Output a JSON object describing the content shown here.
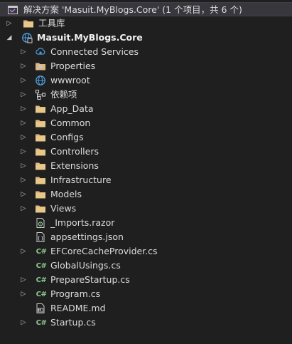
{
  "solution": {
    "label": "解决方案 'Masuit.MyBlogs.Core' (1 个项目，共 6 个)"
  },
  "toolbox": {
    "label": "工具库"
  },
  "project": {
    "label": "Masuit.MyBlogs.Core"
  },
  "items": [
    {
      "label": "Connected Services",
      "icon": "connected-services-icon"
    },
    {
      "label": "Properties",
      "icon": "properties-wrench-icon"
    },
    {
      "label": "wwwroot",
      "icon": "globe-icon"
    },
    {
      "label": "依赖项",
      "icon": "dependencies-icon"
    },
    {
      "label": "App_Data",
      "icon": "folder-icon"
    },
    {
      "label": "Common",
      "icon": "folder-icon"
    },
    {
      "label": "Configs",
      "icon": "folder-icon"
    },
    {
      "label": "Controllers",
      "icon": "folder-icon"
    },
    {
      "label": "Extensions",
      "icon": "folder-icon"
    },
    {
      "label": "Infrastructure",
      "icon": "folder-icon"
    },
    {
      "label": "Models",
      "icon": "folder-icon"
    },
    {
      "label": "Views",
      "icon": "folder-icon"
    },
    {
      "label": "_Imports.razor",
      "icon": "razor-file-icon"
    },
    {
      "label": "appsettings.json",
      "icon": "json-file-icon"
    },
    {
      "label": "EFCoreCacheProvider.cs",
      "icon": "csharp-file-icon"
    },
    {
      "label": "GlobalUsings.cs",
      "icon": "csharp-file-icon"
    },
    {
      "label": "PrepareStartup.cs",
      "icon": "csharp-file-icon"
    },
    {
      "label": "Program.cs",
      "icon": "csharp-file-icon"
    },
    {
      "label": "README.md",
      "icon": "markdown-file-icon"
    },
    {
      "label": "Startup.cs",
      "icon": "csharp-file-icon"
    }
  ],
  "colors": {
    "background": "#1f1f1f",
    "selected_row": "#37373d",
    "folder": "#dcb67a",
    "csharp": "#8dc891",
    "globe": "#4f9fe0",
    "text": "#dcdcdc"
  }
}
